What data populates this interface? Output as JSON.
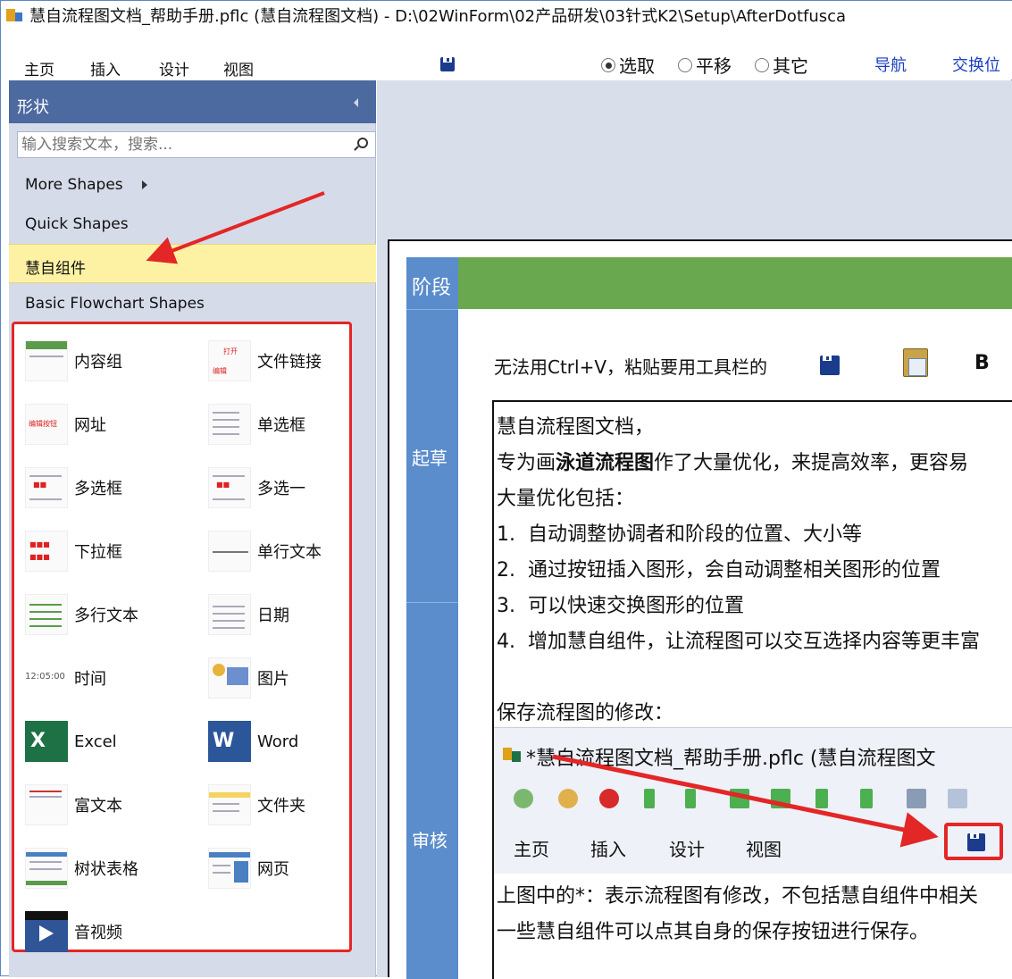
{
  "window": {
    "title": "慧自流程图文档_帮助手册.pflc (慧自流程图文档)  -  D:\\02WinForm\\02产品研发\\03针式K2\\Setup\\AfterDotfusca"
  },
  "menu": {
    "tabs": [
      "主页",
      "插入",
      "设计",
      "视图"
    ],
    "radios": [
      {
        "label": "选取",
        "checked": true
      },
      {
        "label": "平移",
        "checked": false
      },
      {
        "label": "其它",
        "checked": false
      }
    ],
    "links": [
      "导航",
      "交换位"
    ]
  },
  "shapes_panel": {
    "title": "形状",
    "search_placeholder": "输入搜索文本，搜索...",
    "categories": [
      {
        "label": "More Shapes",
        "has_submenu": true
      },
      {
        "label": "Quick Shapes"
      },
      {
        "label": "慧自组件",
        "selected": true
      },
      {
        "label": "Basic Flowchart Shapes"
      }
    ],
    "items": [
      "内容组",
      "文件链接",
      "网址",
      "单选框",
      "多选框",
      "多选一",
      "下拉框",
      "单行文本",
      "多行文本",
      "日期",
      "时间",
      "图片",
      "Excel",
      "Word",
      "富文本",
      "文件夹",
      "树状表格",
      "网页",
      "音视频"
    ],
    "thumb_texts": {
      "time": "12:05:00",
      "excel_x": "X",
      "word_w": "W",
      "link_open": "打开",
      "link_edit": "编辑",
      "url_text": "编辑按钮"
    }
  },
  "canvas": {
    "phase_header": "阶段",
    "lanes": [
      "起草",
      "审核"
    ],
    "note": "无法用Ctrl+V，粘贴要用工具栏的",
    "bold_label": "B",
    "lines": [
      {
        "text": "慧自流程图文档，"
      },
      {
        "pre": "专为画",
        "bold": "泳道流程图",
        "post": "作了大量优化，来提高效率，更容易"
      },
      {
        "text": "大量优化包括："
      },
      {
        "num": "1.",
        "text": "自动调整协调者和阶段的位置、大小等"
      },
      {
        "num": "2.",
        "text": "通过按钮插入图形，会自动调整相关图形的位置"
      },
      {
        "num": "3.",
        "text": "可以快速交换图形的位置"
      },
      {
        "num": "4.",
        "text": "增加慧自组件，让流程图可以交互选择内容等更丰富"
      },
      {
        "text": "保存流程图的修改："
      }
    ],
    "embedded": {
      "title": "*慧自流程图文档_帮助手册.pflc (慧自流程图文",
      "tabs": [
        "主页",
        "插入",
        "设计",
        "视图"
      ]
    },
    "after_lines": [
      "上图中的*：表示流程图有修改，不包括慧自组件中相关",
      "一些慧自组件可以点其自身的保存按钮进行保存。"
    ]
  },
  "colors": {
    "panel_header": "#4c69a0",
    "selected_category": "#fdf2a4",
    "lane_blue": "#5b8ccc",
    "phase_green": "#6aa84f",
    "annotation_red": "#e32626"
  }
}
